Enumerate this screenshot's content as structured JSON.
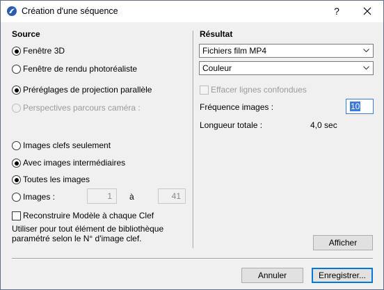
{
  "window": {
    "title": "Création d'une séquence",
    "help_label": "?"
  },
  "source": {
    "heading": "Source",
    "window_options": [
      {
        "label": "Fenêtre 3D",
        "checked": true
      },
      {
        "label": "Fenêtre de rendu photoréaliste",
        "checked": false
      }
    ],
    "projection_options": [
      {
        "label": "Préréglages de projection parallèle",
        "checked": true
      },
      {
        "label": "Perspectives parcours caméra :",
        "checked": false,
        "disabled": true
      }
    ],
    "keyframe_options": [
      {
        "label": "Images clefs seulement",
        "checked": false
      },
      {
        "label": "Avec images intermédiaires",
        "checked": true
      }
    ],
    "range_options": {
      "all_label": "Toutes les images",
      "all_checked": true,
      "images_label": "Images :",
      "images_checked": false,
      "from_value": "1",
      "to_label": "à",
      "to_value": "41"
    },
    "rebuild_checkbox_label": "Reconstruire Modèle à chaque Clef",
    "rebuild_checked": false,
    "note": "Utiliser pour tout élément de bibliothèque paramétré selon le N° d'image clef."
  },
  "result": {
    "heading": "Résultat",
    "format_value": "Fichiers film MP4",
    "color_value": "Couleur",
    "erase_lines_label": "Effacer lignes confondues",
    "erase_lines_checked": false,
    "frequency_label": "Fréquence images :",
    "frequency_value": "10",
    "total_length_label": "Longueur totale :",
    "total_length_value": "4,0 sec",
    "show_button": "Afficher"
  },
  "footer": {
    "cancel_button": "Annuler",
    "save_button": "Enregistrer..."
  },
  "colors": {
    "accent": "#0078d7",
    "selection": "#3b7ad8"
  }
}
